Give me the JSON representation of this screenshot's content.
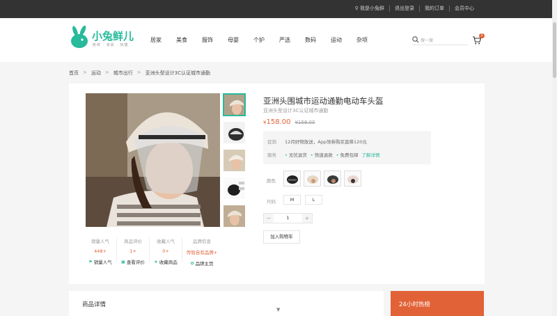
{
  "topbar": {
    "user": "⚲ 我是小兔鲜",
    "logout": "退出登录",
    "orders": "我的订单",
    "member": "会员中心"
  },
  "header": {
    "brand": "小兔鲜儿",
    "slogan": "新鲜 · 亲民 · 快捷",
    "nav": [
      "居家",
      "美食",
      "服饰",
      "母婴",
      "个护",
      "严选",
      "数码",
      "运动",
      "杂项"
    ],
    "search_placeholder": "搜一搜",
    "cart_count": "2"
  },
  "breadcrumb": [
    "首页",
    "运动",
    "城市出行",
    "亚洲头型设计3C认证城市通勤"
  ],
  "product": {
    "title": "亚洲头围城市运动通勤电动车头盔",
    "subtitle": "亚洲头型设计3C认证城市通勤",
    "currency": "¥",
    "price": "158.00",
    "old_price": "¥158.00",
    "promo_label": "促销",
    "promo_text": "12月好物放送，App领券购买直降120元",
    "service_label": "服务",
    "services": [
      "无忧退货",
      "快速退款",
      "免费包邮"
    ],
    "service_link": "了解详情",
    "color_label": "颜色",
    "size_label": "尺码",
    "sizes": [
      "M",
      "L"
    ],
    "quantity": "1",
    "add_to_cart": "加入购物车"
  },
  "stats": [
    {
      "title": "销量人气",
      "value": "448+",
      "link": "销量人气",
      "icon": "flag-icon"
    },
    {
      "title": "商品评价",
      "value": "1+",
      "link": "查看评价",
      "icon": "comment-icon"
    },
    {
      "title": "收藏人气",
      "value": "0+",
      "link": "收藏商品",
      "icon": "star-icon"
    },
    {
      "title": "品牌信息",
      "value": "传智自有品牌+",
      "link": "品牌主页",
      "icon": "brand-icon"
    }
  ],
  "sections": {
    "details": "商品详情",
    "hot": "24小时热榜"
  },
  "colors": {
    "accent": "#27ba9b",
    "price": "#e26237",
    "topbar": "#333333"
  }
}
